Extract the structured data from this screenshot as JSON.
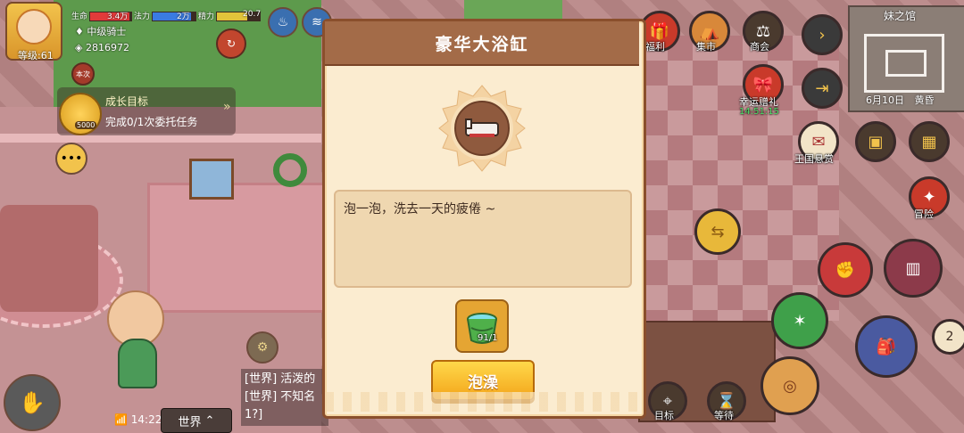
{
  "player": {
    "level_label": "等级:61",
    "rank": "中级骑士",
    "power": "2816972",
    "hp_label": "生命",
    "hp_value": "3.4万",
    "mp_label": "法力",
    "mp_value": "2万",
    "sp_label": "精力",
    "sp_value": "20.7",
    "hp_fraction": 0.95,
    "mp_fraction": 0.9,
    "sp_fraction": 0.7,
    "avatar_badge": "本次"
  },
  "growth_goal": {
    "title": "成长目标",
    "description": "完成0/1次委托任务",
    "reward": "5000"
  },
  "top_right_buttons": [
    {
      "label": "福利",
      "icon": "gift-icon"
    },
    {
      "label": "集市",
      "icon": "market-icon"
    },
    {
      "label": "商会",
      "icon": "guild-icon"
    }
  ],
  "lucky_gift": {
    "label": "幸运赠礼",
    "timer": "14:51:15"
  },
  "kingdom_reward": {
    "label": "王国悬赏"
  },
  "adventure": {
    "label": "冒险"
  },
  "minimap": {
    "title": "妹之馆",
    "date": "6月10日",
    "weather": "黄昏"
  },
  "bottom_buttons": [
    {
      "label": "目标",
      "icon": "target-icon"
    },
    {
      "label": "等待",
      "icon": "hourglass-icon"
    }
  ],
  "chat": {
    "lines": [
      "[世界] 活泼的",
      "[世界] 不知名",
      "1?]"
    ],
    "time": "14:22",
    "channel": "世界"
  },
  "right_hud": {
    "counter": "2"
  },
  "dialog": {
    "title": "豪华大浴缸",
    "description": "泡一泡，洗去一天的疲倦 ~",
    "cost_count": "91/1",
    "action_label": "泡澡"
  },
  "colors": {
    "dialog_bg": "#fbecd0",
    "dialog_header": "#a36b48",
    "button_yellow": "#f3a51a"
  }
}
